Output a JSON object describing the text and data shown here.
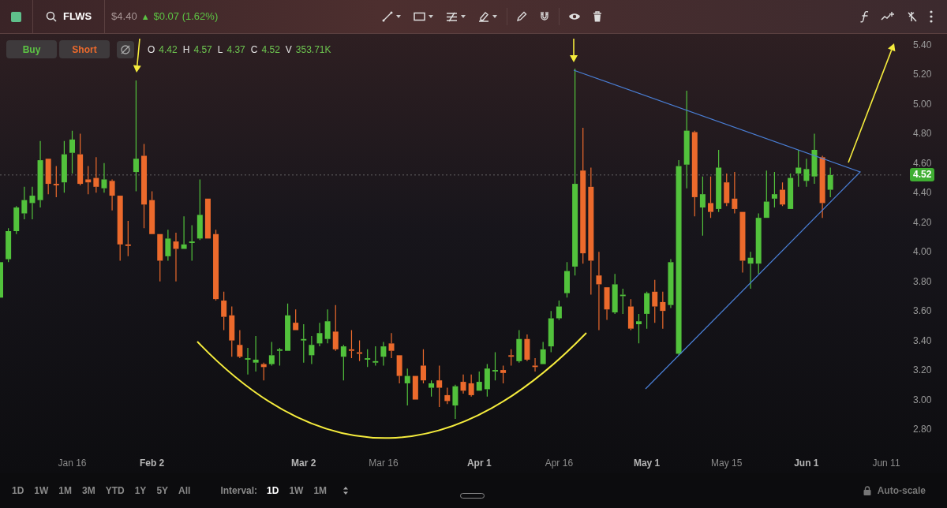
{
  "header": {
    "symbol": "FLWS",
    "price": "$4.40",
    "change_arrow": "▲",
    "change": "$0.07 (1.62%)"
  },
  "actions": [
    {
      "label": "Buy",
      "kind": "buy"
    },
    {
      "label": "Short",
      "kind": "short"
    }
  ],
  "ohlcv": [
    {
      "label": "O",
      "value": "4.42"
    },
    {
      "label": "H",
      "value": "4.57"
    },
    {
      "label": "L",
      "value": "4.37"
    },
    {
      "label": "C",
      "value": "4.52"
    },
    {
      "label": "V",
      "value": "353.71K"
    }
  ],
  "chart": {
    "last_price": "4.52",
    "xtick_styles": [
      {
        "emphasized": false
      },
      {
        "emphasized": true
      },
      {
        "emphasized": true
      },
      {
        "emphasized": false
      },
      {
        "emphasized": true
      },
      {
        "emphasized": false
      },
      {
        "emphasized": true
      },
      {
        "emphasized": false
      },
      {
        "emphasized": true
      },
      {
        "emphasized": false
      }
    ],
    "chart_data": {
      "type": "candlestick",
      "ylim": [
        2.8,
        5.4
      ],
      "categories": [
        null,
        null,
        null,
        null,
        null,
        null,
        null,
        null,
        null,
        "Jan 16",
        null,
        null,
        null,
        null,
        null,
        null,
        null,
        null,
        null,
        "Feb 2",
        null,
        null,
        null,
        null,
        null,
        null,
        null,
        null,
        null,
        null,
        null,
        null,
        null,
        null,
        null,
        null,
        null,
        null,
        "Mar 2",
        null,
        null,
        null,
        null,
        null,
        null,
        null,
        null,
        null,
        "Mar 16",
        null,
        null,
        null,
        null,
        null,
        null,
        null,
        null,
        null,
        null,
        null,
        "Apr 1",
        null,
        null,
        null,
        null,
        null,
        null,
        null,
        null,
        null,
        "Apr 16",
        null,
        null,
        null,
        null,
        null,
        null,
        null,
        null,
        null,
        null,
        "May 1",
        null,
        null,
        null,
        null,
        null,
        null,
        null,
        null,
        null,
        "May 15",
        null,
        null,
        null,
        null,
        null,
        null,
        null,
        null,
        null,
        "Jun 1",
        null,
        null,
        null,
        null,
        null,
        null,
        null,
        null,
        null,
        "Jun 11"
      ],
      "yticks": [
        {
          "value": 5.4,
          "label": "5.40"
        },
        {
          "value": 5.2,
          "label": "5.20"
        },
        {
          "value": 5.0,
          "label": "5.00"
        },
        {
          "value": 4.8,
          "label": "4.80"
        },
        {
          "value": 4.6,
          "label": "4.60"
        },
        {
          "value": 4.4,
          "label": "4.40"
        },
        {
          "value": 4.2,
          "label": "4.20"
        },
        {
          "value": 4.0,
          "label": "4.00"
        },
        {
          "value": 3.8,
          "label": "3.80"
        },
        {
          "value": 3.6,
          "label": "3.60"
        },
        {
          "value": 3.4,
          "label": "3.40"
        },
        {
          "value": 3.2,
          "label": "3.20"
        },
        {
          "value": 3.0,
          "label": "3.00"
        },
        {
          "value": 2.8,
          "label": "2.80"
        }
      ],
      "ref_lines": [
        {
          "axis": "y",
          "value": 4.52
        }
      ],
      "ohlc": [
        [
          3.69,
          3.93,
          3.69,
          3.93
        ],
        [
          3.95,
          4.16,
          3.93,
          4.14
        ],
        [
          4.14,
          4.31,
          4.12,
          4.3
        ],
        [
          4.26,
          4.44,
          4.22,
          4.35
        ],
        [
          4.33,
          4.44,
          4.22,
          4.38
        ],
        [
          4.35,
          4.75,
          4.3,
          4.62
        ],
        [
          4.63,
          4.63,
          4.39,
          4.46
        ],
        [
          4.46,
          4.58,
          4.37,
          4.45
        ],
        [
          4.47,
          4.75,
          4.4,
          4.66
        ],
        [
          4.67,
          4.82,
          4.53,
          4.76
        ],
        [
          4.66,
          4.8,
          4.45,
          4.46
        ],
        [
          4.49,
          4.58,
          4.39,
          4.47
        ],
        [
          4.5,
          4.64,
          4.4,
          4.44
        ],
        [
          4.43,
          4.6,
          4.4,
          4.49
        ],
        [
          4.48,
          4.49,
          4.28,
          4.38
        ],
        [
          4.38,
          4.38,
          3.94,
          4.05
        ],
        [
          4.05,
          4.21,
          3.97,
          4.04
        ],
        [
          4.54,
          5.16,
          4.41,
          4.63
        ],
        [
          4.65,
          4.73,
          4.16,
          4.32
        ],
        [
          4.35,
          4.41,
          4.12,
          4.12
        ],
        [
          4.12,
          4.12,
          3.8,
          3.94
        ],
        [
          3.97,
          4.15,
          3.94,
          4.09
        ],
        [
          4.07,
          4.13,
          3.8,
          4.02
        ],
        [
          4.02,
          4.24,
          4.02,
          4.05
        ],
        [
          4.06,
          4.18,
          3.94,
          4.07
        ],
        [
          4.09,
          4.49,
          4.08,
          4.25
        ],
        [
          4.36,
          4.36,
          4.09,
          4.09
        ],
        [
          4.12,
          4.15,
          3.67,
          3.68
        ],
        [
          3.67,
          3.73,
          3.47,
          3.56
        ],
        [
          3.57,
          3.63,
          3.29,
          3.4
        ],
        [
          3.37,
          3.47,
          3.28,
          3.29
        ],
        [
          3.27,
          3.35,
          3.17,
          3.28
        ],
        [
          3.25,
          3.43,
          3.19,
          3.27
        ],
        [
          3.24,
          3.25,
          3.13,
          3.22
        ],
        [
          3.24,
          3.39,
          3.23,
          3.3
        ],
        [
          3.33,
          3.35,
          3.23,
          3.34
        ],
        [
          3.33,
          3.65,
          3.33,
          3.57
        ],
        [
          3.52,
          3.61,
          3.47,
          3.47
        ],
        [
          3.4,
          3.51,
          3.25,
          3.41
        ],
        [
          3.3,
          3.43,
          3.24,
          3.37
        ],
        [
          3.38,
          3.52,
          3.36,
          3.45
        ],
        [
          3.41,
          3.61,
          3.38,
          3.53
        ],
        [
          3.46,
          3.64,
          3.33,
          3.34
        ],
        [
          3.29,
          3.37,
          3.13,
          3.36
        ],
        [
          3.34,
          3.47,
          3.28,
          3.33
        ],
        [
          3.32,
          3.4,
          3.26,
          3.31
        ],
        [
          3.27,
          3.34,
          3.22,
          3.28
        ],
        [
          3.25,
          3.36,
          3.23,
          3.26
        ],
        [
          3.29,
          3.39,
          3.23,
          3.36
        ],
        [
          3.38,
          3.45,
          3.28,
          3.33
        ],
        [
          3.3,
          3.3,
          3.11,
          3.16
        ],
        [
          3.11,
          3.21,
          2.96,
          3.16
        ],
        [
          3.16,
          3.16,
          3.0,
          3.0
        ],
        [
          3.23,
          3.34,
          3.11,
          3.13
        ],
        [
          3.08,
          3.13,
          3.02,
          3.11
        ],
        [
          3.13,
          3.23,
          2.95,
          3.08
        ],
        [
          3.03,
          3.08,
          2.97,
          2.99
        ],
        [
          2.96,
          3.1,
          2.87,
          3.09
        ],
        [
          3.12,
          3.17,
          3.04,
          3.06
        ],
        [
          3.11,
          3.17,
          3.02,
          3.03
        ],
        [
          3.06,
          3.19,
          3.06,
          3.12
        ],
        [
          3.07,
          3.24,
          3.02,
          3.21
        ],
        [
          3.19,
          3.32,
          3.13,
          3.2
        ],
        [
          3.2,
          3.23,
          3.11,
          3.18
        ],
        [
          3.3,
          3.34,
          3.23,
          3.29
        ],
        [
          3.26,
          3.47,
          3.25,
          3.41
        ],
        [
          3.41,
          3.44,
          3.26,
          3.27
        ],
        [
          3.23,
          3.28,
          3.19,
          3.22
        ],
        [
          3.24,
          3.39,
          3.24,
          3.34
        ],
        [
          3.36,
          3.6,
          3.32,
          3.55
        ],
        [
          3.55,
          3.67,
          3.54,
          3.63
        ],
        [
          3.72,
          3.93,
          3.69,
          3.87
        ],
        [
          3.9,
          5.24,
          3.84,
          4.46
        ],
        [
          4.55,
          4.84,
          3.92,
          3.99
        ],
        [
          4.44,
          4.57,
          3.71,
          3.94
        ],
        [
          3.84,
          4.0,
          3.47,
          3.78
        ],
        [
          3.76,
          3.76,
          3.54,
          3.61
        ],
        [
          3.59,
          3.85,
          3.58,
          3.78
        ],
        [
          3.7,
          3.75,
          3.58,
          3.71
        ],
        [
          3.63,
          3.68,
          3.47,
          3.48
        ],
        [
          3.51,
          3.58,
          3.38,
          3.53
        ],
        [
          3.58,
          3.73,
          3.48,
          3.72
        ],
        [
          3.73,
          3.81,
          3.52,
          3.63
        ],
        [
          3.66,
          3.73,
          3.48,
          3.6
        ],
        [
          3.64,
          3.95,
          3.62,
          3.93
        ],
        [
          3.31,
          4.62,
          3.3,
          4.58
        ],
        [
          4.59,
          5.09,
          4.43,
          4.82
        ],
        [
          4.81,
          4.82,
          4.24,
          4.37
        ],
        [
          4.3,
          4.51,
          4.11,
          4.39
        ],
        [
          4.33,
          4.51,
          4.23,
          4.27
        ],
        [
          4.29,
          4.69,
          4.27,
          4.57
        ],
        [
          4.47,
          4.53,
          4.31,
          4.33
        ],
        [
          4.36,
          4.54,
          4.26,
          4.29
        ],
        [
          4.27,
          4.27,
          3.86,
          3.94
        ],
        [
          3.92,
          4.0,
          3.75,
          3.96
        ],
        [
          3.92,
          4.26,
          3.85,
          4.23
        ],
        [
          4.23,
          4.55,
          4.23,
          4.34
        ],
        [
          4.36,
          4.54,
          4.3,
          4.39
        ],
        [
          4.42,
          4.47,
          4.31,
          4.32
        ],
        [
          4.29,
          4.53,
          4.29,
          4.5
        ],
        [
          4.53,
          4.69,
          4.44,
          4.57
        ],
        [
          4.48,
          4.63,
          4.44,
          4.56
        ],
        [
          4.51,
          4.8,
          4.46,
          4.69
        ],
        [
          4.64,
          4.65,
          4.23,
          4.33
        ],
        [
          4.42,
          4.57,
          4.37,
          4.52
        ],
        null,
        null,
        null,
        null,
        null,
        null,
        null
      ]
    }
  },
  "ranges": [
    {
      "label": "1D",
      "selected": false
    },
    {
      "label": "1W",
      "selected": false
    },
    {
      "label": "1M",
      "selected": false
    },
    {
      "label": "3M",
      "selected": false
    },
    {
      "label": "YTD",
      "selected": false
    },
    {
      "label": "1Y",
      "selected": false
    },
    {
      "label": "5Y",
      "selected": false
    },
    {
      "label": "All",
      "selected": false
    }
  ],
  "interval_label": "Interval:",
  "intervals": [
    {
      "label": "1D",
      "selected": true
    },
    {
      "label": "1W",
      "selected": false
    },
    {
      "label": "1M",
      "selected": false
    }
  ],
  "auto_scale": "Auto-scale"
}
